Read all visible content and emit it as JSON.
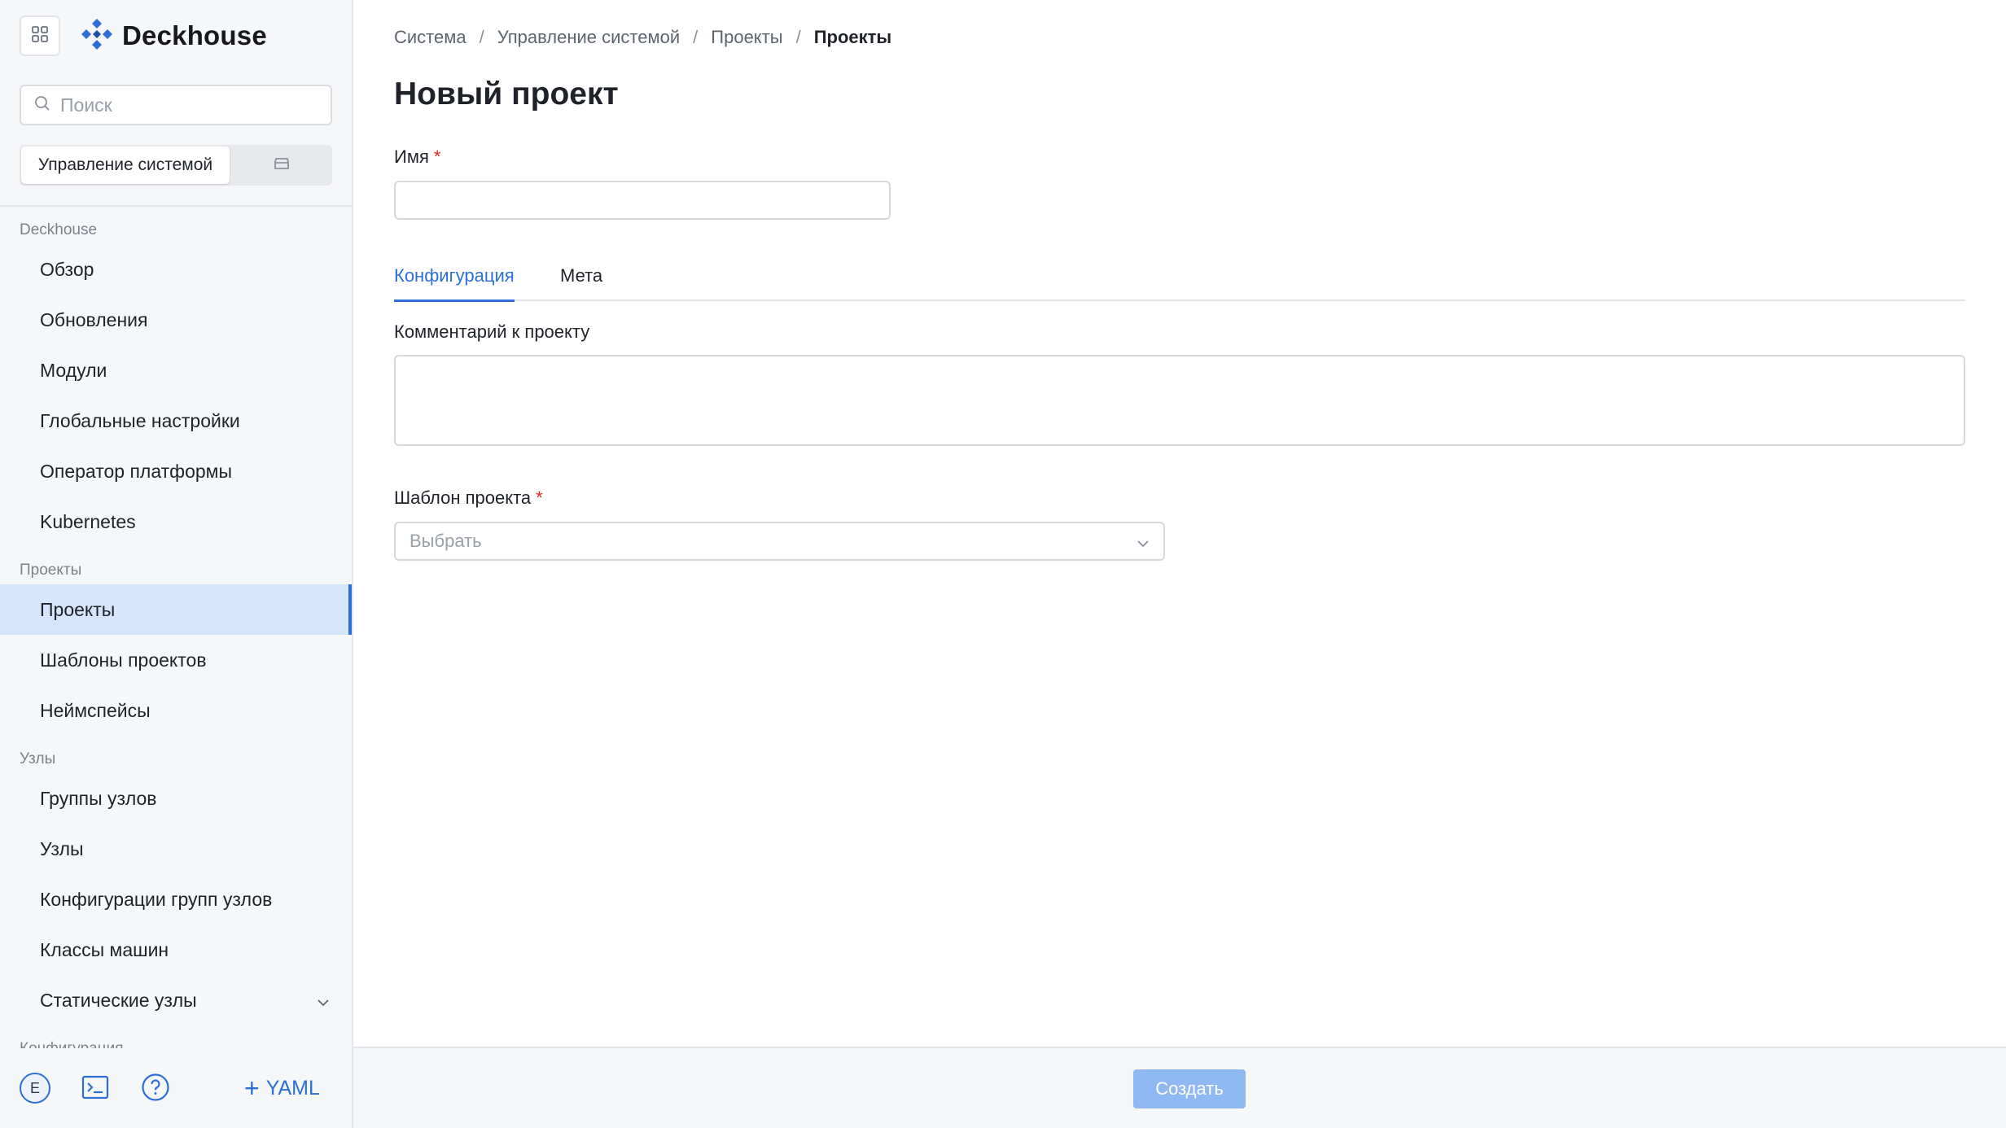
{
  "app": {
    "name": "Deckhouse"
  },
  "sidebar": {
    "search_placeholder": "Поиск",
    "segment": {
      "active_label": "Управление системой",
      "other_icon": "box-icon"
    },
    "groups": [
      {
        "label": "Deckhouse",
        "items": [
          "Обзор",
          "Обновления",
          "Модули",
          "Глобальные настройки",
          "Оператор платформы",
          "Kubernetes"
        ]
      },
      {
        "label": "Проекты",
        "items": [
          "Проекты",
          "Шаблоны проектов",
          "Неймспейсы"
        ]
      },
      {
        "label": "Узлы",
        "items": [
          "Группы узлов",
          "Узлы",
          "Конфигурации групп узлов",
          "Классы машин",
          "Статические узлы"
        ]
      },
      {
        "label": "Конфигурация",
        "items": []
      }
    ],
    "active_item": "Проекты",
    "footer": {
      "avatar_letter": "E",
      "yaml_label": "YAML"
    }
  },
  "breadcrumb": [
    "Система",
    "Управление системой",
    "Проекты",
    "Проекты"
  ],
  "page": {
    "title": "Новый проект",
    "name_label": "Имя",
    "required_mark": "*",
    "name_value": "",
    "tabs": [
      "Конфигурация",
      "Мета"
    ],
    "active_tab": "Конфигурация",
    "comment_label": "Комментарий к проекту",
    "comment_value": "",
    "template_label": "Шаблон проекта",
    "template_placeholder": "Выбрать"
  },
  "footer": {
    "create_label": "Создать"
  },
  "colors": {
    "accent": "#2d6fd8",
    "active_bg": "#d5e5fc",
    "required": "#e5252a",
    "disabled_button": "#90b8f2"
  }
}
